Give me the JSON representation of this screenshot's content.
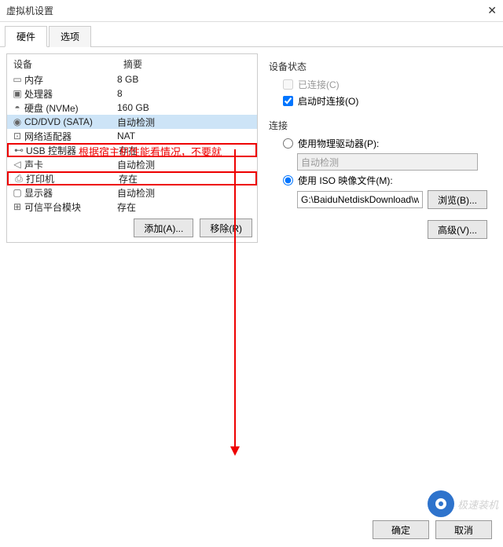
{
  "window": {
    "title": "虚拟机设置"
  },
  "tabs": {
    "hardware": "硬件",
    "options": "选项"
  },
  "left": {
    "header_device": "设备",
    "header_summary": "摘要",
    "rows": [
      {
        "name": "内存",
        "summary": "8 GB"
      },
      {
        "name": "处理器",
        "summary": "8"
      },
      {
        "name": "硬盘 (NVMe)",
        "summary": "160 GB"
      },
      {
        "name": "CD/DVD (SATA)",
        "summary": "自动检测"
      },
      {
        "name": "网络适配器",
        "summary": "NAT"
      },
      {
        "name": "USB 控制器",
        "summary": "存在"
      },
      {
        "name": "声卡",
        "summary": "自动检测"
      },
      {
        "name": "打印机",
        "summary": "存在"
      },
      {
        "name": "显示器",
        "summary": "自动检测"
      },
      {
        "name": "可信平台模块",
        "summary": "存在"
      }
    ],
    "add_btn": "添加(A)...",
    "remove_btn": "移除(R)"
  },
  "right": {
    "device_status_title": "设备状态",
    "connected": "已连接(C)",
    "connect_at_poweron": "启动时连接(O)",
    "connection_title": "连接",
    "use_physical": "使用物理驱动器(P):",
    "physical_value": "自动检测",
    "use_iso": "使用 ISO 映像文件(M):",
    "iso_value": "G:\\BaiduNetdiskDownload\\w",
    "browse_btn": "浏览(B)...",
    "advanced_btn": "高级(V)..."
  },
  "bottom": {
    "ok": "确定",
    "cancel": "取消"
  },
  "annotation": {
    "text": "根据宿主机性能看情况，不要就"
  },
  "watermark": {
    "text": "极速装机"
  }
}
